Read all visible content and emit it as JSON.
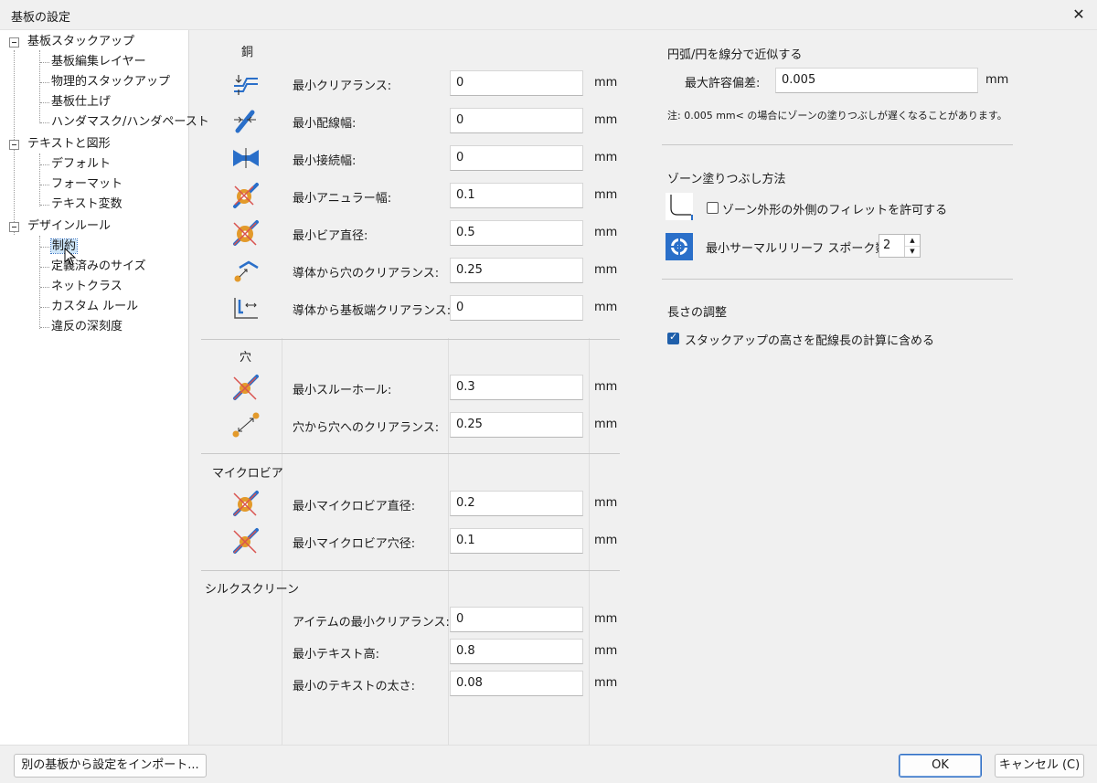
{
  "window": {
    "title": "基板の設定",
    "close_glyph": "✕"
  },
  "tree": {
    "items": [
      {
        "label": "基板スタックアップ",
        "level": 0
      },
      {
        "label": "基板編集レイヤー",
        "level": 1
      },
      {
        "label": "物理的スタックアップ",
        "level": 1
      },
      {
        "label": "基板仕上げ",
        "level": 1
      },
      {
        "label": "ハンダマスク/ハンダペースト",
        "level": 1
      },
      {
        "label": "テキストと図形",
        "level": 0
      },
      {
        "label": "デフォルト",
        "level": 1
      },
      {
        "label": "フォーマット",
        "level": 1
      },
      {
        "label": "テキスト変数",
        "level": 1
      },
      {
        "label": "デザインルール",
        "level": 0
      },
      {
        "label": "制約",
        "level": 1,
        "selected": true
      },
      {
        "label": "定義済みのサイズ",
        "level": 1
      },
      {
        "label": "ネットクラス",
        "level": 1
      },
      {
        "label": "カスタム ルール",
        "level": 1
      },
      {
        "label": "違反の深刻度",
        "level": 1
      }
    ]
  },
  "copper": {
    "heading": "銅",
    "fields": [
      {
        "label": "最小クリアランス:",
        "value": "0",
        "unit": "mm",
        "icon": "clearance-icon"
      },
      {
        "label": "最小配線幅:",
        "value": "0",
        "unit": "mm",
        "icon": "track-width-icon"
      },
      {
        "label": "最小接続幅:",
        "value": "0",
        "unit": "mm",
        "icon": "connection-width-icon"
      },
      {
        "label": "最小アニュラー幅:",
        "value": "0.1",
        "unit": "mm",
        "icon": "annular-width-icon"
      },
      {
        "label": "最小ビア直径:",
        "value": "0.5",
        "unit": "mm",
        "icon": "via-diameter-icon"
      },
      {
        "label": "導体から穴のクリアランス:",
        "value": "0.25",
        "unit": "mm",
        "icon": "copper-hole-clearance-icon"
      },
      {
        "label": "導体から基板端クリアランス:",
        "value": "0",
        "unit": "mm",
        "icon": "edge-clearance-icon"
      }
    ]
  },
  "holes": {
    "heading": "穴",
    "fields": [
      {
        "label": "最小スルーホール:",
        "value": "0.3",
        "unit": "mm",
        "icon": "through-hole-icon"
      },
      {
        "label": "穴から穴へのクリアランス:",
        "value": "0.25",
        "unit": "mm",
        "icon": "hole-to-hole-icon"
      }
    ]
  },
  "microvias": {
    "heading": "マイクロビア",
    "fields": [
      {
        "label": "最小マイクロビア直径:",
        "value": "0.2",
        "unit": "mm",
        "icon": "microvia-diameter-icon"
      },
      {
        "label": "最小マイクロビア穴径:",
        "value": "0.1",
        "unit": "mm",
        "icon": "microvia-drill-icon"
      }
    ]
  },
  "silkscreen": {
    "heading": "シルクスクリーン",
    "fields": [
      {
        "label": "アイテムの最小クリアランス:",
        "value": "0",
        "unit": "mm"
      },
      {
        "label": "最小テキスト高:",
        "value": "0.8",
        "unit": "mm"
      },
      {
        "label": "最小のテキストの太さ:",
        "value": "0.08",
        "unit": "mm"
      }
    ]
  },
  "arcs": {
    "heading": "円弧/円を線分で近似する",
    "max_error_label": "最大許容偏差:",
    "max_error_value": "0.005",
    "unit": "mm",
    "note": "注: 0.005 mm< の場合にゾーンの塗りつぶしが遅くなることがあります。"
  },
  "zone_fill": {
    "heading": "ゾーン塗りつぶし方法",
    "fillet_label": "ゾーン外形の外側のフィレットを許可する",
    "fillet_checked": false,
    "spokes_label": "最小サーマルリリーフ スポーク数:",
    "spokes_value": "2"
  },
  "length_tuning": {
    "heading": "長さの調整",
    "stackup_label": "スタックアップの高さを配線長の計算に含める",
    "stackup_checked": true
  },
  "footer": {
    "import_label": "別の基板から設定をインポート...",
    "ok_label": "OK",
    "cancel_label": "キャンセル (C)"
  },
  "colors": {
    "accent": "#1f5faa",
    "icon_blue": "#2a6fc9",
    "icon_orange": "#e39a2b",
    "icon_red": "#d9534f"
  }
}
